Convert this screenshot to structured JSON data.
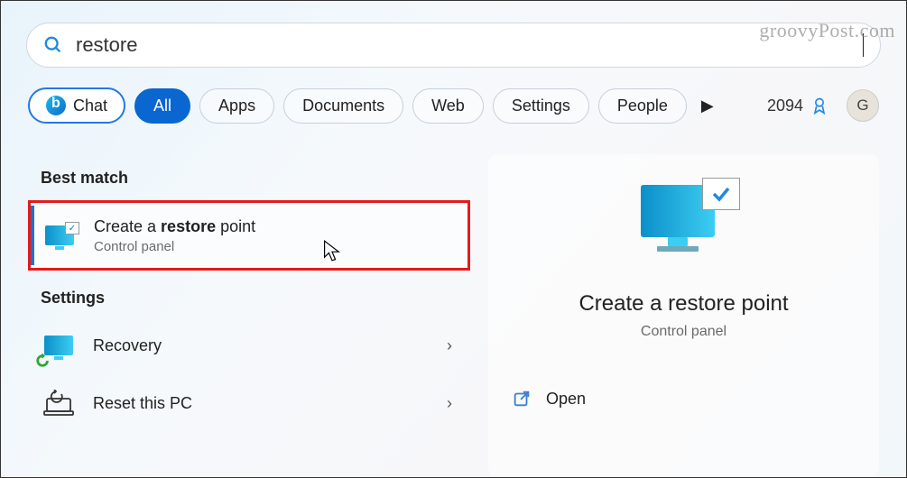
{
  "watermark": "groovyPost.com",
  "search": {
    "value": "restore"
  },
  "filters": {
    "chat": "Chat",
    "all": "All",
    "items": [
      "Apps",
      "Documents",
      "Web",
      "Settings",
      "People"
    ]
  },
  "rewards": {
    "points": "2094"
  },
  "avatar": {
    "initial": "G"
  },
  "sections": {
    "best_match": "Best match",
    "settings": "Settings"
  },
  "results": {
    "best": {
      "title_pre": "Create a ",
      "title_bold": "restore",
      "title_post": " point",
      "subtitle": "Control panel"
    },
    "settings": [
      {
        "title": "Recovery"
      },
      {
        "title": "Reset this PC"
      }
    ]
  },
  "detail": {
    "title": "Create a restore point",
    "subtitle": "Control panel",
    "actions": {
      "open": "Open"
    }
  }
}
